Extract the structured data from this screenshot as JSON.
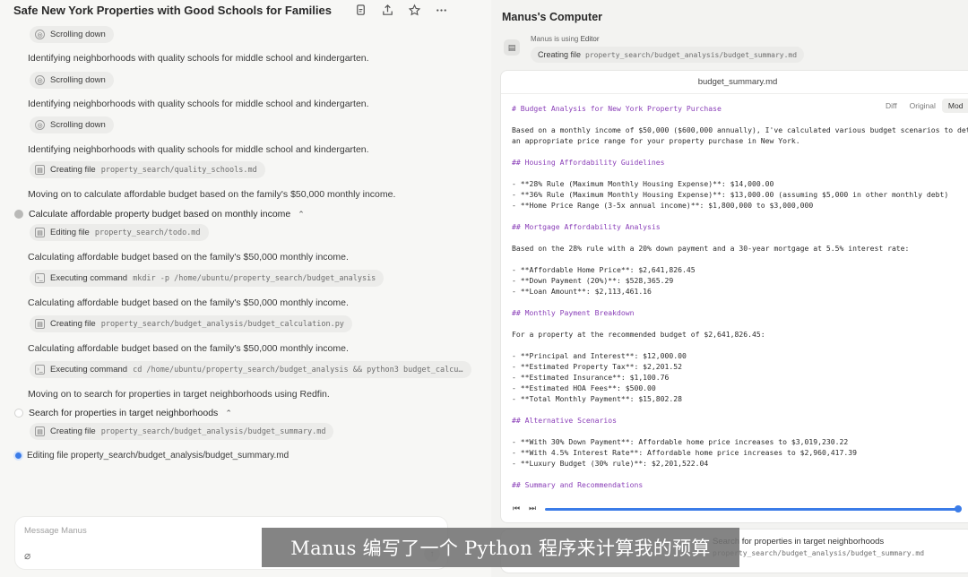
{
  "left": {
    "title": "Safe New York Properties with Good Schools for Families",
    "header_icons": [
      "copy-icon",
      "share-icon",
      "star-icon",
      "more-icon"
    ],
    "feed": [
      {
        "kind": "chip",
        "icon": "globe-icon",
        "label": "Scrolling down",
        "path": ""
      },
      {
        "kind": "msg",
        "text": "Identifying neighborhoods with quality schools for middle school and kindergarten."
      },
      {
        "kind": "chip",
        "icon": "globe-icon",
        "label": "Scrolling down",
        "path": ""
      },
      {
        "kind": "msg",
        "text": "Identifying neighborhoods with quality schools for middle school and kindergarten."
      },
      {
        "kind": "chip",
        "icon": "globe-icon",
        "label": "Scrolling down",
        "path": ""
      },
      {
        "kind": "msg",
        "text": "Identifying neighborhoods with quality schools for middle school and kindergarten."
      },
      {
        "kind": "chip",
        "icon": "file-icon",
        "label": "Creating file",
        "path": "property_search/quality_schools.md"
      },
      {
        "kind": "msg",
        "text": "Moving on to calculate affordable budget based on the family's $50,000 monthly income."
      },
      {
        "kind": "step",
        "state": "done",
        "text": "Calculate affordable property budget based on monthly income"
      },
      {
        "kind": "chip",
        "icon": "file-icon",
        "label": "Editing file",
        "path": "property_search/todo.md"
      },
      {
        "kind": "msg",
        "text": "Calculating affordable budget based on the family's $50,000 monthly income."
      },
      {
        "kind": "chip",
        "icon": "terminal-icon",
        "label": "Executing command",
        "path": "mkdir -p /home/ubuntu/property_search/budget_analysis"
      },
      {
        "kind": "msg",
        "text": "Calculating affordable budget based on the family's $50,000 monthly income."
      },
      {
        "kind": "chip",
        "icon": "file-icon",
        "label": "Creating file",
        "path": "property_search/budget_analysis/budget_calculation.py"
      },
      {
        "kind": "msg",
        "text": "Calculating affordable budget based on the family's $50,000 monthly income."
      },
      {
        "kind": "chip",
        "icon": "terminal-icon",
        "label": "Executing command",
        "path": "cd /home/ubuntu/property_search/budget_analysis && python3 budget_calcu…"
      },
      {
        "kind": "msg",
        "text": "Moving on to search for properties in target neighborhoods using Redfin."
      },
      {
        "kind": "step",
        "state": "empty",
        "text": "Search for properties in target neighborhoods"
      },
      {
        "kind": "chip",
        "icon": "file-icon",
        "label": "Creating file",
        "path": "property_search/budget_analysis/budget_summary.md"
      },
      {
        "kind": "step",
        "state": "active",
        "text": "Editing file property_search/budget_analysis/budget_summary.md"
      }
    ],
    "message_placeholder": "Message Manus",
    "attach_icon": "paperclip-icon",
    "send_icon": "arrow-up-icon"
  },
  "right": {
    "title": "Manus's Computer",
    "using_prefix": "Manus is using",
    "using_tool": "Editor",
    "creating_label": "Creating file",
    "creating_path": "property_search/budget_analysis/budget_summary.md",
    "editor": {
      "filename": "budget_summary.md",
      "tabs": [
        "Diff",
        "Original",
        "Mod"
      ],
      "selected_tab": "Mod",
      "lines": [
        "# Budget Analysis for New York Property Purchase",
        "",
        "Based on a monthly income of $50,000 ($600,000 annually), I've calculated various budget scenarios to dete",
        "an appropriate price range for your property purchase in New York.",
        "",
        "## Housing Affordability Guidelines",
        "",
        "- **28% Rule (Maximum Monthly Housing Expense)**: $14,000.00",
        "- **36% Rule (Maximum Monthly Housing Expense)**: $13,000.00 (assuming $5,000 in other monthly debt)",
        "- **Home Price Range (3-5x annual income)**: $1,800,000 to $3,000,000",
        "",
        "## Mortgage Affordability Analysis",
        "",
        "Based on the 28% rule with a 20% down payment and a 30-year mortgage at 5.5% interest rate:",
        "",
        "- **Affordable Home Price**: $2,641,826.45",
        "- **Down Payment (20%)**: $528,365.29",
        "- **Loan Amount**: $2,113,461.16",
        "",
        "## Monthly Payment Breakdown",
        "",
        "For a property at the recommended budget of $2,641,826.45:",
        "",
        "- **Principal and Interest**: $12,000.00",
        "- **Estimated Property Tax**: $2,201.52",
        "- **Estimated Insurance**: $1,100.76",
        "- **Estimated HOA Fees**: $500.00",
        "- **Total Monthly Payment**: $15,802.28",
        "",
        "## Alternative Scenarios",
        "",
        "- **With 30% Down Payment**: Affordable home price increases to $3,019,230.22",
        "- **With 4.5% Interest Rate**: Affordable home price increases to $2,960,417.39",
        "- **Luxury Budget (30% rule)**: $2,201,522.04",
        "",
        "## Summary and Recommendations"
      ]
    },
    "playback_progress": 0.99,
    "task_card": {
      "title": "Search for properties in target neighborhoods",
      "path": "property_search/budget_analysis/budget_summary.md"
    }
  },
  "subtitle": "Manus 编写了一个 Python 程序来计算我的预算"
}
